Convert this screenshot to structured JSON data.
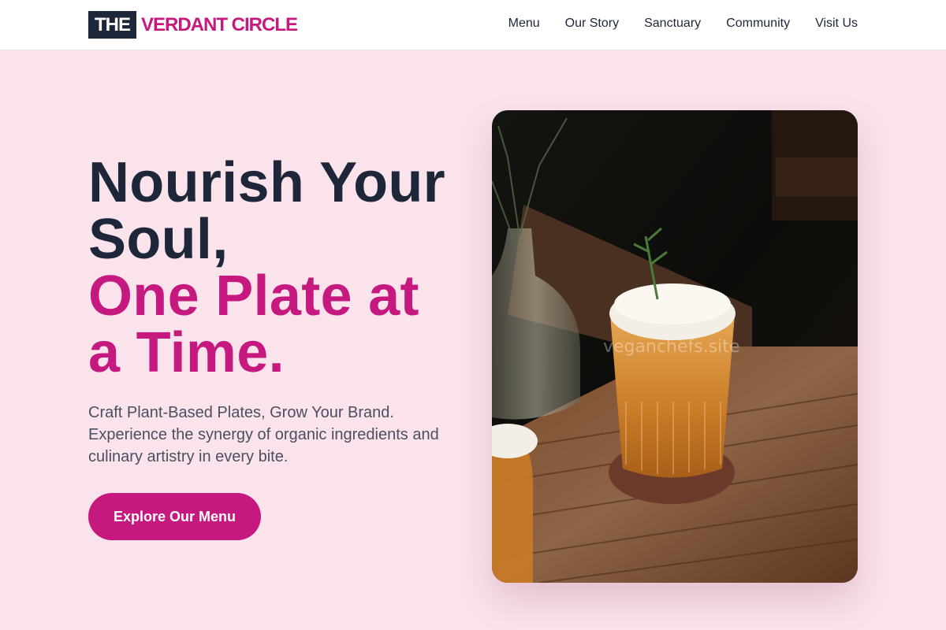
{
  "brand": {
    "logo_box": "THE",
    "logo_text": "VERDANT CIRCLE",
    "colors": {
      "dark": "#1e2639",
      "accent": "#c6197f",
      "background": "#fbe3ec"
    }
  },
  "nav": {
    "items": [
      {
        "label": "Menu"
      },
      {
        "label": "Our Story"
      },
      {
        "label": "Sanctuary"
      },
      {
        "label": "Community"
      },
      {
        "label": "Visit Us"
      }
    ]
  },
  "hero": {
    "headline_line1": "Nourish Your",
    "headline_line2": "Soul,",
    "headline_line3": "One Plate at",
    "headline_line4": "a Time.",
    "subtext": "Craft Plant-Based Plates, Grow Your Brand. Experience the synergy of organic ingredients and culinary artistry in every bite.",
    "cta_label": "Explore Our Menu",
    "image_watermark": "veganchefs.site"
  }
}
